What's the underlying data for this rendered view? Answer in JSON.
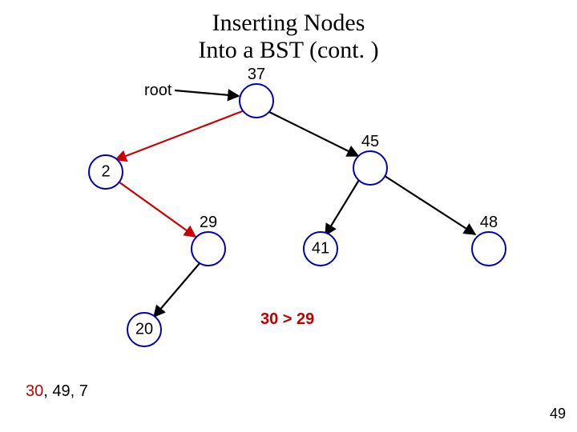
{
  "title": {
    "line1": "Inserting Nodes",
    "line2": "Into a BST (cont. )"
  },
  "root_label": "root",
  "nodes": {
    "n37": "37",
    "n2": "2",
    "n45": "45",
    "n29": "29",
    "n41": "41",
    "n48": "48",
    "n20": "20"
  },
  "comparison": "30 > 29",
  "queue": {
    "highlight": "30",
    "rest": ", 49, 7"
  },
  "slide_number": "49",
  "chart_data": {
    "type": "tree",
    "title": "Inserting Nodes Into a BST (cont.)",
    "root_pointer": "37",
    "nodes": [
      37,
      2,
      45,
      29,
      41,
      48,
      20
    ],
    "edges": [
      {
        "from": 37,
        "to": 2,
        "kind": "left",
        "highlight": true
      },
      {
        "from": 37,
        "to": 45,
        "kind": "right",
        "highlight": false
      },
      {
        "from": 2,
        "to": 29,
        "kind": "right",
        "highlight": true
      },
      {
        "from": 45,
        "to": 41,
        "kind": "left",
        "highlight": false
      },
      {
        "from": 45,
        "to": 48,
        "kind": "right",
        "highlight": false
      },
      {
        "from": 29,
        "to": 20,
        "kind": "left",
        "highlight": false
      }
    ],
    "root_arrow": {
      "from_label": "root",
      "to": 37
    },
    "insert_queue": [
      30,
      49,
      7
    ],
    "current_insert": 30,
    "current_comparison": {
      "value": 30,
      "against": 29,
      "relation": ">"
    }
  }
}
